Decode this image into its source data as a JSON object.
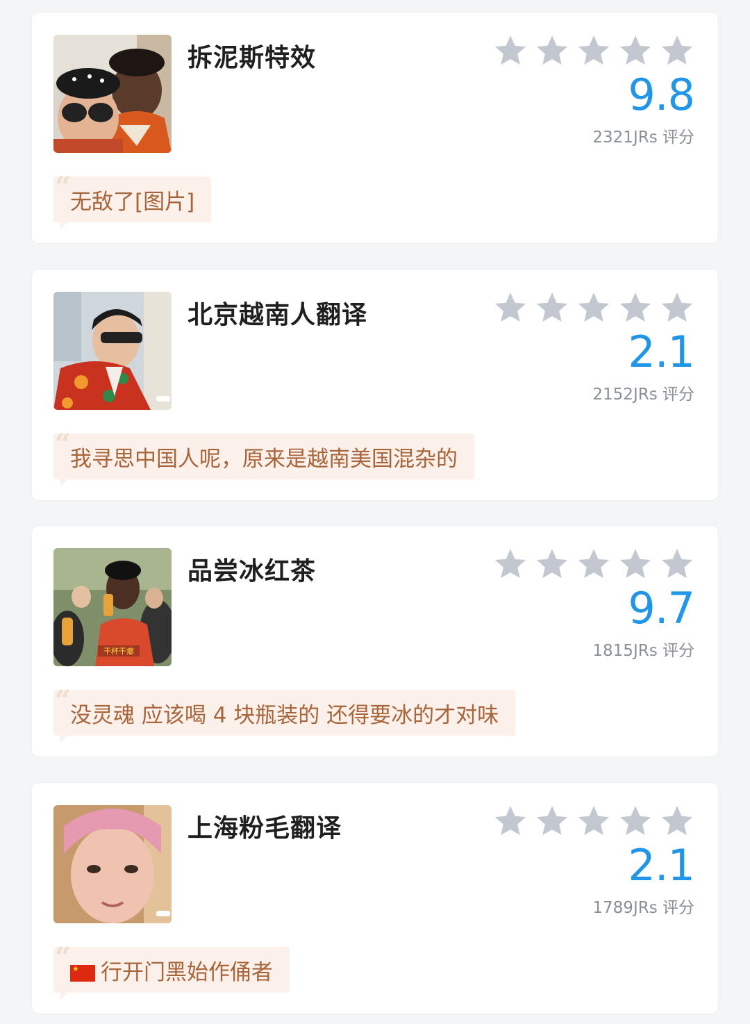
{
  "cards": [
    {
      "name": "拆泥斯特效",
      "score": "9.8",
      "count": "2321JRs 评分",
      "comment": "无敌了[图片]",
      "stars": 5
    },
    {
      "name": "北京越南人翻译",
      "score": "2.1",
      "count": "2152JRs 评分",
      "comment": "我寻思中国人呢，原来是越南美国混杂的",
      "stars": 5
    },
    {
      "name": "品尝冰红茶",
      "score": "9.7",
      "count": "1815JRs 评分",
      "comment": "没灵魂 应该喝 4 块瓶装的 还得要冰的才对味",
      "thumb_caption": "干杯干瘪",
      "stars": 5
    },
    {
      "name": "上海粉毛翻译",
      "score": "2.1",
      "count": "1789JRs 评分",
      "comment": "行开门黑始作俑者",
      "comment_prefix_icon": "china-flag-icon",
      "stars": 5
    }
  ],
  "colors": {
    "score": "#2196e8",
    "star": "#c3c8d0",
    "comment_bg": "#fbf1ea",
    "comment_text": "#a8643a"
  }
}
